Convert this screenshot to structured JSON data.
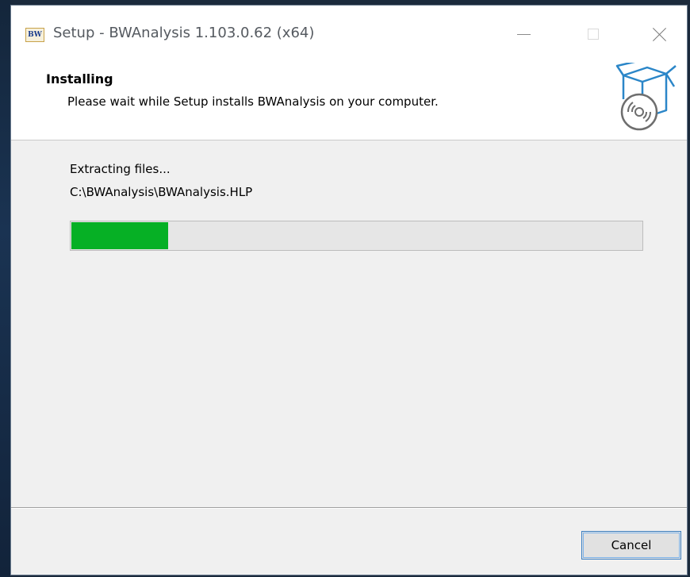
{
  "window": {
    "app_icon_text": "BW",
    "title": "Setup - BWAnalysis 1.103.0.62 (x64)"
  },
  "header": {
    "title": "Installing",
    "subtitle": "Please wait while Setup installs BWAnalysis on your computer."
  },
  "body": {
    "status": "Extracting files...",
    "current_file": "C:\\BWAnalysis\\BWAnalysis.HLP",
    "progress_percent": 17,
    "progress_color": "#06b025"
  },
  "buttons": {
    "cancel_label": "Cancel"
  },
  "icons": {
    "app": "bwanalysis-app-icon",
    "setup_graphic": "software-box-disc-icon",
    "minimize": "minimize-icon",
    "maximize": "maximize-icon",
    "close": "close-icon"
  }
}
